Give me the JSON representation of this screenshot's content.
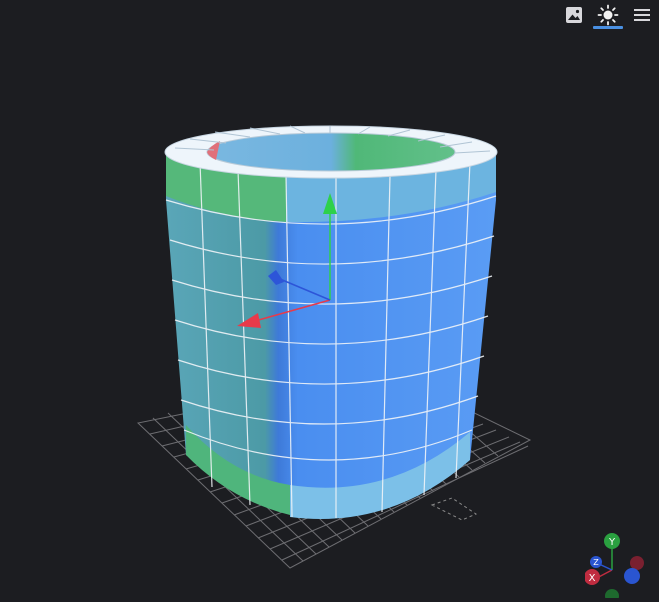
{
  "toolbar": {
    "items": [
      {
        "icon": "image-icon",
        "active": false
      },
      {
        "icon": "sun-icon",
        "active": true
      },
      {
        "icon": "menu-icon",
        "active": false
      }
    ],
    "accent_color": "#4a90e2"
  },
  "scene": {
    "object": "hollow-cylinder",
    "colors": {
      "background": "#1c1d21",
      "grid": "#8a8a8a",
      "face_blue": "#5596f0",
      "face_teal": "#4f9aa2",
      "face_green": "#50b878",
      "face_light": "#8fc8ea",
      "face_top": "#e8f2fa",
      "x_axis": "#e83a4a",
      "y_axis": "#2ed14a",
      "z_axis": "#2d55d8"
    }
  },
  "view_gizmo": {
    "labels": {
      "x": "X",
      "y": "Y",
      "z": "Z"
    },
    "colors": {
      "x": "#c02c40",
      "y": "#2aa040",
      "z": "#2a55d0"
    }
  }
}
